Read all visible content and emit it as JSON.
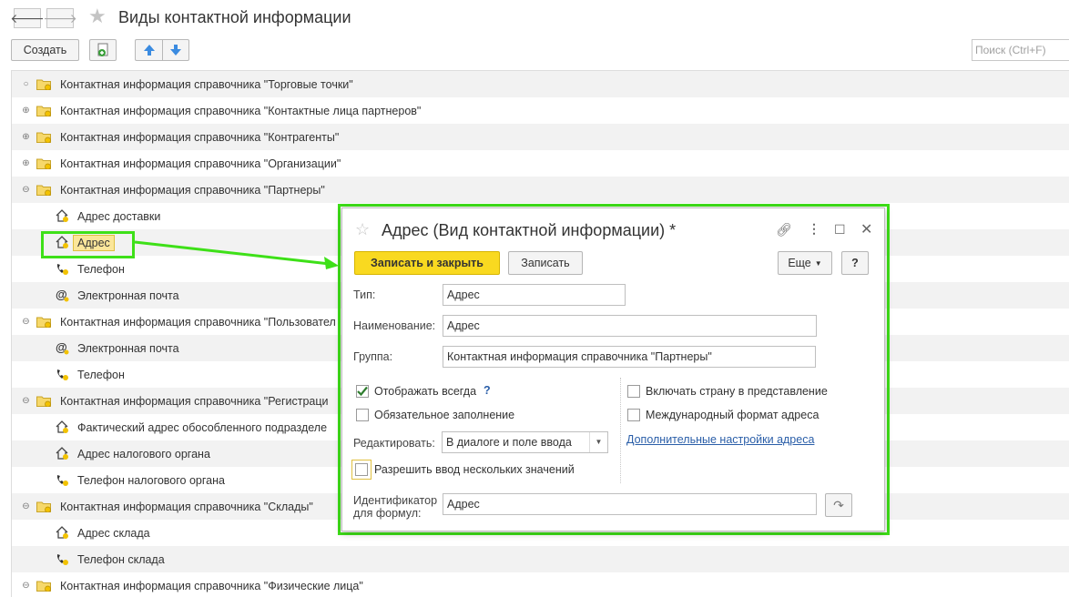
{
  "window": {
    "title": "Виды контактной информации"
  },
  "toolbar": {
    "create_label": "Создать",
    "search_placeholder": "Поиск (Ctrl+F)"
  },
  "tree": {
    "rows": [
      {
        "type": "group",
        "exp": "○",
        "label": "Контактная информация справочника \"Торговые точки\""
      },
      {
        "type": "group",
        "exp": "⊕",
        "label": "Контактная информация справочника \"Контактные лица партнеров\""
      },
      {
        "type": "group",
        "exp": "⊕",
        "label": "Контактная информация справочника \"Контрагенты\""
      },
      {
        "type": "group",
        "exp": "⊕",
        "label": "Контактная информация справочника \"Организации\""
      },
      {
        "type": "group",
        "exp": "⊖",
        "label": "Контактная информация справочника \"Партнеры\""
      },
      {
        "type": "item",
        "icon": "home-icon",
        "label": "Адрес доставки"
      },
      {
        "type": "item",
        "icon": "home-icon",
        "label": "Адрес",
        "selected": true
      },
      {
        "type": "item",
        "icon": "phone-icon",
        "label": "Телефон"
      },
      {
        "type": "item",
        "icon": "at-icon",
        "label": "Электронная почта"
      },
      {
        "type": "group",
        "exp": "⊖",
        "label": "Контактная информация справочника \"Пользовател"
      },
      {
        "type": "item",
        "icon": "at-icon",
        "label": "Электронная почта"
      },
      {
        "type": "item",
        "icon": "phone-icon",
        "label": "Телефон"
      },
      {
        "type": "group",
        "exp": "⊖",
        "label": "Контактная информация справочника \"Регистраци"
      },
      {
        "type": "item",
        "icon": "home-icon",
        "label": "Фактический адрес обособленного подразделе"
      },
      {
        "type": "item",
        "icon": "home-icon",
        "label": "Адрес налогового органа"
      },
      {
        "type": "item",
        "icon": "phone-icon",
        "label": "Телефон налогового органа"
      },
      {
        "type": "group",
        "exp": "⊖",
        "label": "Контактная информация справочника \"Склады\""
      },
      {
        "type": "item",
        "icon": "home-icon",
        "label": "Адрес склада"
      },
      {
        "type": "item",
        "icon": "phone-icon",
        "label": "Телефон склада"
      },
      {
        "type": "group",
        "exp": "⊖",
        "label": "Контактная информация справочника \"Физические лица\""
      }
    ]
  },
  "dialog": {
    "title": "Адрес (Вид контактной информации) *",
    "save_close_label": "Записать и закрыть",
    "save_label": "Записать",
    "more_label": "Еще",
    "help_label": "?",
    "type_label": "Тип:",
    "type_value": "Адрес",
    "name_label": "Наименование:",
    "name_value": "Адрес",
    "group_label": "Группа:",
    "group_value": "Контактная информация справочника \"Партнеры\"",
    "show_always_label": "Отображать всегда",
    "show_always_help": "?",
    "required_label": "Обязательное заполнение",
    "edit_label": "Редактировать:",
    "edit_value": "В диалоге и поле ввода",
    "multi_label": "Разрешить ввод нескольких значений",
    "include_country_label": "Включать страну в представление",
    "intl_format_label": "Международный формат адреса",
    "extra_settings_link": "Дополнительные настройки адреса",
    "identifier_label_1": "Идентификатор",
    "identifier_label_2": "для формул:",
    "identifier_value": "Адрес"
  },
  "colors": {
    "highlight_green": "#3ee018",
    "primary_yellow": "#f9d920",
    "selection": "#fbe69a"
  }
}
